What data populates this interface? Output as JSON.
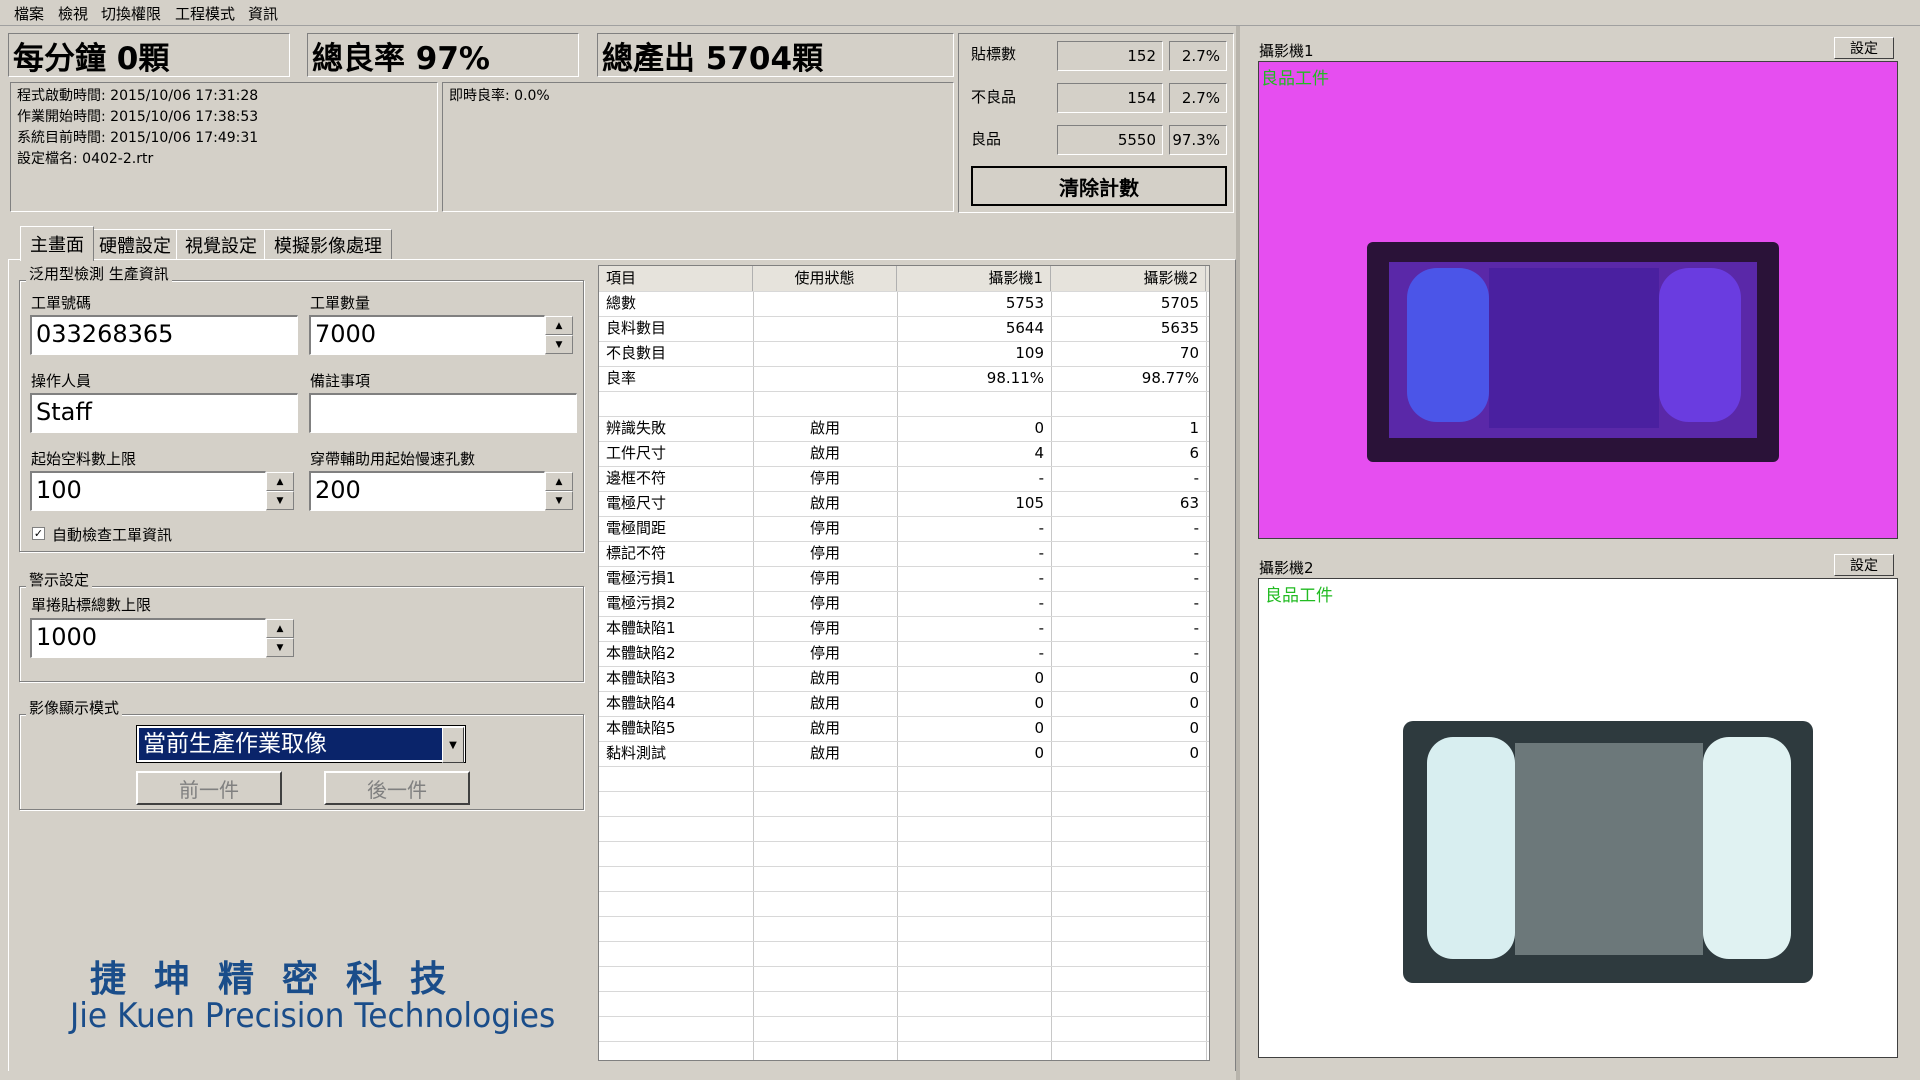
{
  "menu": [
    "檔案",
    "檢視",
    "切換權限",
    "工程模式",
    "資訊"
  ],
  "summary": {
    "per_minute": "每分鐘 0顆",
    "yield_rate": "總良率 97%",
    "total_output": "總產出 5704顆"
  },
  "info": {
    "lines": [
      "程式啟動時間: 2015/10/06 17:31:28",
      "作業開始時間: 2015/10/06 17:38:53",
      "系統目前時間: 2015/10/06 17:49:31",
      "設定檔名: 0402-2.rtr"
    ],
    "instant_yield": "即時良率: 0.0%"
  },
  "counts": [
    {
      "label": "貼標數",
      "value": "152",
      "pct": "2.7%"
    },
    {
      "label": "不良品",
      "value": "154",
      "pct": "2.7%"
    },
    {
      "label": "良品",
      "value": "5550",
      "pct": "97.3%"
    }
  ],
  "clear_button": "清除計數",
  "tabs": [
    "主畫面",
    "硬體設定",
    "視覺設定",
    "模擬影像處理"
  ],
  "production_group": {
    "title": "泛用型檢測 生產資訊",
    "order_no_label": "工單號碼",
    "order_no": "033268365",
    "order_qty_label": "工單數量",
    "order_qty": "7000",
    "operator_label": "操作人員",
    "operator": "Staff",
    "notes_label": "備註事項",
    "notes": "",
    "empty_limit_label": "起始空料數上限",
    "empty_limit": "100",
    "tape_speed_label": "穿帶輔助用起始慢速孔數",
    "tape_speed": "200",
    "auto_check_label": "自動檢查工單資訊",
    "auto_check": true
  },
  "alarm_group": {
    "title": "警示設定",
    "label_limit_label": "單捲貼標總數上限",
    "label_limit": "1000"
  },
  "display_group": {
    "title": "影像顯示模式",
    "mode": "當前生產作業取像",
    "prev": "前一件",
    "next": "後一件"
  },
  "table": {
    "headers": [
      "項目",
      "使用狀態",
      "攝影機1",
      "攝影機2"
    ],
    "rows": [
      [
        "總數",
        "",
        "5753",
        "5705"
      ],
      [
        "良料數目",
        "",
        "5644",
        "5635"
      ],
      [
        "不良數目",
        "",
        "109",
        "70"
      ],
      [
        "良率",
        "",
        "98.11%",
        "98.77%"
      ],
      [
        "",
        "",
        "",
        ""
      ],
      [
        "辨識失敗",
        "啟用",
        "0",
        "1"
      ],
      [
        "工件尺寸",
        "啟用",
        "4",
        "6"
      ],
      [
        "邊框不符",
        "停用",
        "-",
        "-"
      ],
      [
        "電極尺寸",
        "啟用",
        "105",
        "63"
      ],
      [
        "電極間距",
        "停用",
        "-",
        "-"
      ],
      [
        "標記不符",
        "停用",
        "-",
        "-"
      ],
      [
        "電極污損1",
        "停用",
        "-",
        "-"
      ],
      [
        "電極污損2",
        "停用",
        "-",
        "-"
      ],
      [
        "本體缺陷1",
        "停用",
        "-",
        "-"
      ],
      [
        "本體缺陷2",
        "停用",
        "-",
        "-"
      ],
      [
        "本體缺陷3",
        "啟用",
        "0",
        "0"
      ],
      [
        "本體缺陷4",
        "啟用",
        "0",
        "0"
      ],
      [
        "本體缺陷5",
        "啟用",
        "0",
        "0"
      ],
      [
        "黏料測試",
        "啟用",
        "0",
        "0"
      ]
    ]
  },
  "logo": {
    "cn": "捷坤精密科技",
    "en": "Jie Kuen Precision Technologies"
  },
  "camera1": {
    "title": "攝影機1",
    "setting": "設定",
    "overlay": "良品工件"
  },
  "camera2": {
    "title": "攝影機2",
    "setting": "設定",
    "overlay": "良品工件"
  },
  "colors": {
    "window_bg": "#d4d0c8",
    "logo_blue": "#1a4d8a",
    "select_bg": "#0a246a",
    "camera1_bg": "#e64ef0",
    "overlay_green": "#22bb22"
  }
}
